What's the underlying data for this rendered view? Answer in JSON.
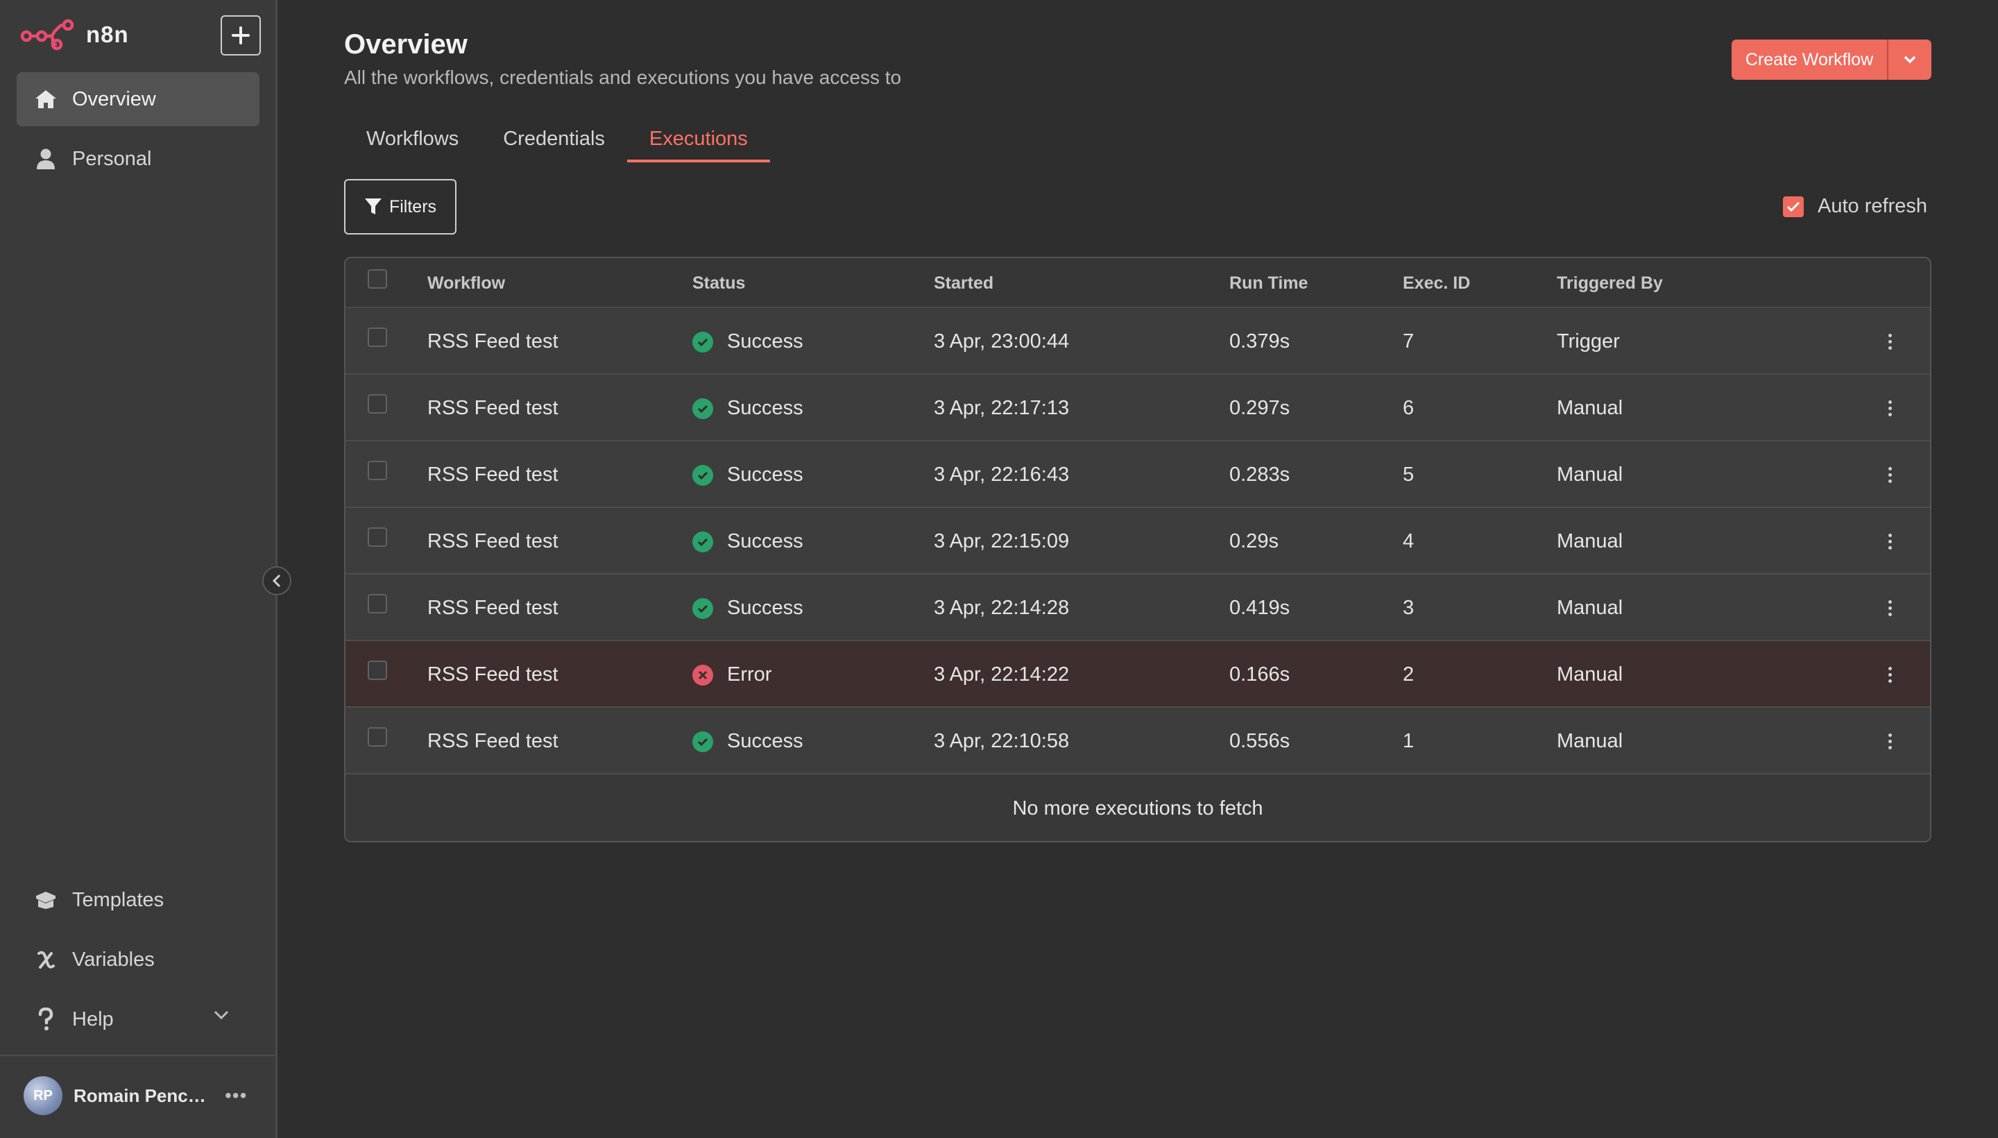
{
  "app": {
    "name": "n8n",
    "accent": "#ff7262"
  },
  "sidebar": {
    "new_button_icon": "plus-icon",
    "nav_top": [
      {
        "label": "Overview",
        "icon": "home-icon",
        "active": true
      },
      {
        "label": "Personal",
        "icon": "user-icon",
        "active": false
      }
    ],
    "nav_bottom": [
      {
        "label": "Templates",
        "icon": "box-icon"
      },
      {
        "label": "Variables",
        "icon": "variable-icon"
      },
      {
        "label": "Help",
        "icon": "question-icon"
      }
    ],
    "user": {
      "initials": "RP",
      "name": "Romain Pench..."
    }
  },
  "header": {
    "title": "Overview",
    "subtitle": "All the workflows, credentials and executions you have access to",
    "create_button": "Create Workflow"
  },
  "tabs": [
    {
      "label": "Workflows",
      "active": false
    },
    {
      "label": "Credentials",
      "active": false
    },
    {
      "label": "Executions",
      "active": true
    }
  ],
  "toolbar": {
    "filters_label": "Filters",
    "auto_refresh_label": "Auto refresh",
    "auto_refresh_checked": true
  },
  "table": {
    "columns": [
      "Workflow",
      "Status",
      "Started",
      "Run Time",
      "Exec. ID",
      "Triggered By"
    ],
    "rows": [
      {
        "workflow": "RSS Feed test",
        "status": "Success",
        "started": "3 Apr, 23:00:44",
        "runtime": "0.379s",
        "id": "7",
        "trigger": "Trigger"
      },
      {
        "workflow": "RSS Feed test",
        "status": "Success",
        "started": "3 Apr, 22:17:13",
        "runtime": "0.297s",
        "id": "6",
        "trigger": "Manual"
      },
      {
        "workflow": "RSS Feed test",
        "status": "Success",
        "started": "3 Apr, 22:16:43",
        "runtime": "0.283s",
        "id": "5",
        "trigger": "Manual"
      },
      {
        "workflow": "RSS Feed test",
        "status": "Success",
        "started": "3 Apr, 22:15:09",
        "runtime": "0.29s",
        "id": "4",
        "trigger": "Manual"
      },
      {
        "workflow": "RSS Feed test",
        "status": "Success",
        "started": "3 Apr, 22:14:28",
        "runtime": "0.419s",
        "id": "3",
        "trigger": "Manual"
      },
      {
        "workflow": "RSS Feed test",
        "status": "Error",
        "started": "3 Apr, 22:14:22",
        "runtime": "0.166s",
        "id": "2",
        "trigger": "Manual"
      },
      {
        "workflow": "RSS Feed test",
        "status": "Success",
        "started": "3 Apr, 22:10:58",
        "runtime": "0.556s",
        "id": "1",
        "trigger": "Manual"
      }
    ],
    "footer": "No more executions to fetch"
  }
}
